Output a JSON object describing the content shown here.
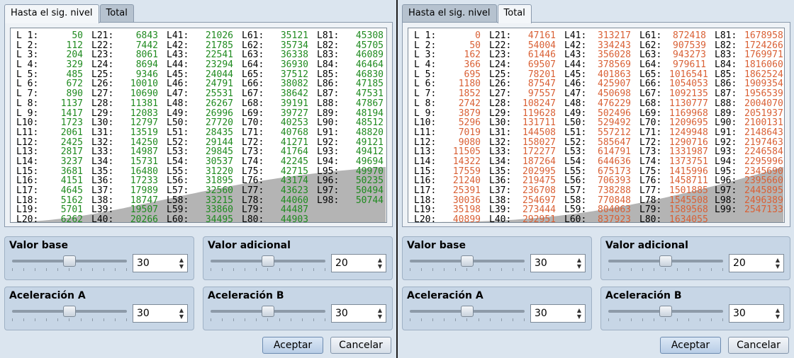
{
  "left": {
    "tabs": [
      {
        "label": "Hasta el sig. nivel"
      },
      {
        "label": "Total"
      }
    ],
    "active_tab": 0,
    "value_color": "#1f8a1f",
    "levels": [
      [
        "L 1:",
        "50"
      ],
      [
        "L 2:",
        "112"
      ],
      [
        "L 3:",
        "204"
      ],
      [
        "L 4:",
        "329"
      ],
      [
        "L 5:",
        "485"
      ],
      [
        "L 6:",
        "672"
      ],
      [
        "L 7:",
        "890"
      ],
      [
        "L 8:",
        "1137"
      ],
      [
        "L 9:",
        "1417"
      ],
      [
        "L10:",
        "1723"
      ],
      [
        "L11:",
        "2061"
      ],
      [
        "L12:",
        "2425"
      ],
      [
        "L13:",
        "2817"
      ],
      [
        "L14:",
        "3237"
      ],
      [
        "L15:",
        "3681"
      ],
      [
        "L16:",
        "4151"
      ],
      [
        "L17:",
        "4645"
      ],
      [
        "L18:",
        "5162"
      ],
      [
        "L19:",
        "5701"
      ],
      [
        "L20:",
        "6262"
      ],
      [
        "L21:",
        "6843"
      ],
      [
        "L22:",
        "7442"
      ],
      [
        "L23:",
        "8061"
      ],
      [
        "L24:",
        "8694"
      ],
      [
        "L25:",
        "9346"
      ],
      [
        "L26:",
        "10010"
      ],
      [
        "L27:",
        "10690"
      ],
      [
        "L28:",
        "11381"
      ],
      [
        "L29:",
        "12083"
      ],
      [
        "L30:",
        "12797"
      ],
      [
        "L31:",
        "13519"
      ],
      [
        "L32:",
        "14250"
      ],
      [
        "L33:",
        "14987"
      ],
      [
        "L34:",
        "15731"
      ],
      [
        "L35:",
        "16480"
      ],
      [
        "L36:",
        "17233"
      ],
      [
        "L37:",
        "17989"
      ],
      [
        "L38:",
        "18747"
      ],
      [
        "L39:",
        "19507"
      ],
      [
        "L40:",
        "20266"
      ],
      [
        "L41:",
        "21026"
      ],
      [
        "L42:",
        "21785"
      ],
      [
        "L43:",
        "22541"
      ],
      [
        "L44:",
        "23294"
      ],
      [
        "L45:",
        "24044"
      ],
      [
        "L46:",
        "24791"
      ],
      [
        "L47:",
        "25531"
      ],
      [
        "L48:",
        "26267"
      ],
      [
        "L49:",
        "26996"
      ],
      [
        "L50:",
        "27720"
      ],
      [
        "L51:",
        "28435"
      ],
      [
        "L52:",
        "29144"
      ],
      [
        "L53:",
        "29845"
      ],
      [
        "L54:",
        "30537"
      ],
      [
        "L55:",
        "31220"
      ],
      [
        "L56:",
        "31895"
      ],
      [
        "L57:",
        "32560"
      ],
      [
        "L58:",
        "33215"
      ],
      [
        "L59:",
        "33860"
      ],
      [
        "L60:",
        "34495"
      ],
      [
        "L61:",
        "35121"
      ],
      [
        "L62:",
        "35734"
      ],
      [
        "L63:",
        "36338"
      ],
      [
        "L64:",
        "36930"
      ],
      [
        "L65:",
        "37512"
      ],
      [
        "L66:",
        "38082"
      ],
      [
        "L67:",
        "38642"
      ],
      [
        "L68:",
        "39191"
      ],
      [
        "L69:",
        "39727"
      ],
      [
        "L70:",
        "40253"
      ],
      [
        "L71:",
        "40768"
      ],
      [
        "L72:",
        "41271"
      ],
      [
        "L73:",
        "41764"
      ],
      [
        "L74:",
        "42245"
      ],
      [
        "L75:",
        "42715"
      ],
      [
        "L76:",
        "43174"
      ],
      [
        "L77:",
        "43623"
      ],
      [
        "L78:",
        "44060"
      ],
      [
        "L79:",
        "44487"
      ],
      [
        "L80:",
        "44903"
      ],
      [
        "L81:",
        "45308"
      ],
      [
        "L82:",
        "45705"
      ],
      [
        "L83:",
        "46089"
      ],
      [
        "L84:",
        "46464"
      ],
      [
        "L85:",
        "46830"
      ],
      [
        "L86:",
        "47185"
      ],
      [
        "L87:",
        "47531"
      ],
      [
        "L88:",
        "47867"
      ],
      [
        "L89:",
        "48194"
      ],
      [
        "L90:",
        "48512"
      ],
      [
        "L91:",
        "48820"
      ],
      [
        "L92:",
        "49121"
      ],
      [
        "L93:",
        "49412"
      ],
      [
        "L94:",
        "49694"
      ],
      [
        "L95:",
        "49970"
      ],
      [
        "L96:",
        "50235"
      ],
      [
        "L97:",
        "50494"
      ],
      [
        "L98:",
        "50744"
      ]
    ],
    "controls": [
      {
        "title": "Valor base",
        "value": "30",
        "level": 0.5
      },
      {
        "title": "Valor adicional",
        "value": "20",
        "level": 0.5
      },
      {
        "title": "Aceleración A",
        "value": "30",
        "level": 0.5
      },
      {
        "title": "Aceleración B",
        "value": "30",
        "level": 0.5
      }
    ],
    "buttons": {
      "accept": "Aceptar",
      "cancel": "Cancelar"
    }
  },
  "right": {
    "tabs": [
      {
        "label": "Hasta el sig. nivel"
      },
      {
        "label": "Total"
      }
    ],
    "active_tab": 1,
    "value_color": "#d96035",
    "levels": [
      [
        "L 1:",
        "0"
      ],
      [
        "L 2:",
        "50"
      ],
      [
        "L 3:",
        "162"
      ],
      [
        "L 4:",
        "366"
      ],
      [
        "L 5:",
        "695"
      ],
      [
        "L 6:",
        "1180"
      ],
      [
        "L 7:",
        "1852"
      ],
      [
        "L 8:",
        "2742"
      ],
      [
        "L 9:",
        "3879"
      ],
      [
        "L10:",
        "5296"
      ],
      [
        "L11:",
        "7019"
      ],
      [
        "L12:",
        "9080"
      ],
      [
        "L13:",
        "11505"
      ],
      [
        "L14:",
        "14322"
      ],
      [
        "L15:",
        "17559"
      ],
      [
        "L16:",
        "21240"
      ],
      [
        "L17:",
        "25391"
      ],
      [
        "L18:",
        "30036"
      ],
      [
        "L19:",
        "35198"
      ],
      [
        "L20:",
        "40899"
      ],
      [
        "L21:",
        "47161"
      ],
      [
        "L22:",
        "54004"
      ],
      [
        "L23:",
        "61446"
      ],
      [
        "L24:",
        "69507"
      ],
      [
        "L25:",
        "78201"
      ],
      [
        "L26:",
        "87547"
      ],
      [
        "L27:",
        "97557"
      ],
      [
        "L28:",
        "108247"
      ],
      [
        "L29:",
        "119628"
      ],
      [
        "L30:",
        "131711"
      ],
      [
        "L31:",
        "144508"
      ],
      [
        "L32:",
        "158027"
      ],
      [
        "L33:",
        "172277"
      ],
      [
        "L34:",
        "187264"
      ],
      [
        "L35:",
        "202995"
      ],
      [
        "L36:",
        "219475"
      ],
      [
        "L37:",
        "236708"
      ],
      [
        "L38:",
        "254697"
      ],
      [
        "L39:",
        "273444"
      ],
      [
        "L40:",
        "292951"
      ],
      [
        "L41:",
        "313217"
      ],
      [
        "L42:",
        "334243"
      ],
      [
        "L43:",
        "356028"
      ],
      [
        "L44:",
        "378569"
      ],
      [
        "L45:",
        "401863"
      ],
      [
        "L46:",
        "425907"
      ],
      [
        "L47:",
        "450698"
      ],
      [
        "L48:",
        "476229"
      ],
      [
        "L49:",
        "502496"
      ],
      [
        "L50:",
        "529492"
      ],
      [
        "L51:",
        "557212"
      ],
      [
        "L52:",
        "585647"
      ],
      [
        "L53:",
        "614791"
      ],
      [
        "L54:",
        "644636"
      ],
      [
        "L55:",
        "675173"
      ],
      [
        "L56:",
        "706393"
      ],
      [
        "L57:",
        "738288"
      ],
      [
        "L58:",
        "770848"
      ],
      [
        "L59:",
        "804063"
      ],
      [
        "L60:",
        "837923"
      ],
      [
        "L61:",
        "872418"
      ],
      [
        "L62:",
        "907539"
      ],
      [
        "L63:",
        "943273"
      ],
      [
        "L64:",
        "979611"
      ],
      [
        "L65:",
        "1016541"
      ],
      [
        "L66:",
        "1054053"
      ],
      [
        "L67:",
        "1092135"
      ],
      [
        "L68:",
        "1130777"
      ],
      [
        "L69:",
        "1169968"
      ],
      [
        "L70:",
        "1209695"
      ],
      [
        "L71:",
        "1249948"
      ],
      [
        "L72:",
        "1290716"
      ],
      [
        "L73:",
        "1331987"
      ],
      [
        "L74:",
        "1373751"
      ],
      [
        "L75:",
        "1415996"
      ],
      [
        "L76:",
        "1458711"
      ],
      [
        "L77:",
        "1501885"
      ],
      [
        "L78:",
        "1545508"
      ],
      [
        "L79:",
        "1589568"
      ],
      [
        "L80:",
        "1634055"
      ],
      [
        "L81:",
        "1678958"
      ],
      [
        "L82:",
        "1724266"
      ],
      [
        "L83:",
        "1769971"
      ],
      [
        "L84:",
        "1816060"
      ],
      [
        "L85:",
        "1862524"
      ],
      [
        "L86:",
        "1909354"
      ],
      [
        "L87:",
        "1956539"
      ],
      [
        "L88:",
        "2004070"
      ],
      [
        "L89:",
        "2051937"
      ],
      [
        "L90:",
        "2100131"
      ],
      [
        "L91:",
        "2148643"
      ],
      [
        "L92:",
        "2197463"
      ],
      [
        "L93:",
        "2246584"
      ],
      [
        "L94:",
        "2295996"
      ],
      [
        "L95:",
        "2345690"
      ],
      [
        "L96:",
        "2395660"
      ],
      [
        "L97:",
        "2445895"
      ],
      [
        "L98:",
        "2496389"
      ],
      [
        "L99:",
        "2547133"
      ]
    ],
    "controls": [
      {
        "title": "Valor base",
        "value": "30",
        "level": 0.5
      },
      {
        "title": "Valor adicional",
        "value": "20",
        "level": 0.5
      },
      {
        "title": "Aceleración A",
        "value": "30",
        "level": 0.5
      },
      {
        "title": "Aceleración B",
        "value": "30",
        "level": 0.5
      }
    ],
    "buttons": {
      "accept": "Aceptar",
      "cancel": "Cancelar"
    }
  }
}
